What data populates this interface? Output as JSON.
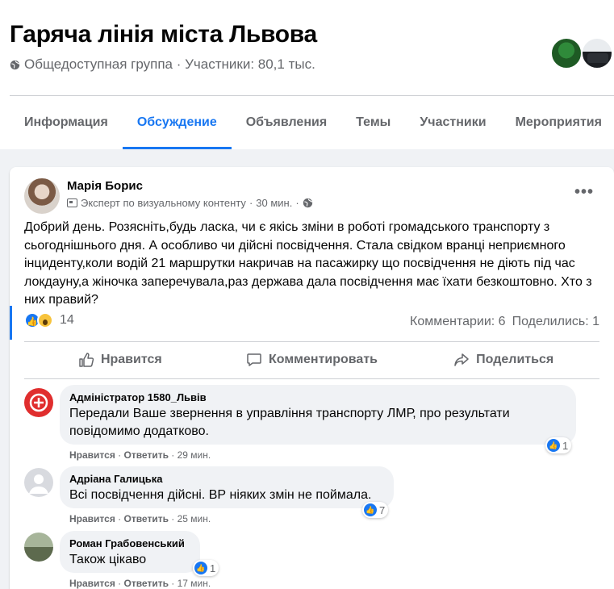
{
  "group": {
    "title": "Гаряча лінія міста Львова",
    "meta": "Общедоступная группа · Участники: 80,1 тыс."
  },
  "tabs": [
    "Информация",
    "Обсуждение",
    "Объявления",
    "Темы",
    "Участники",
    "Мероприятия"
  ],
  "active_tab": "Обсуждение",
  "post": {
    "author": "Марія Борис",
    "badge": "Эксперт по визуальному контенту",
    "time": "30 мин.",
    "text": "Добрий день. Розясніть,будь ласка, чи є якісь зміни в роботі громадського транспорту з сьогоднішнього дня. А особливо чи дійсні посвідчення. Стала свідком вранці неприємного інциденту,коли водій 21 маршрутки накричав на пасажирку що посвідчення не діють під час локдауну,а жіночка заперечувала,раз держава дала посвідчення має їхати безкоштовно. Хто з них правий?",
    "reactions_count": "14",
    "comments_count": "Комментарии: 6",
    "shares_count": "Поделились: 1"
  },
  "actions": {
    "like": "Нравится",
    "comment": "Комментировать",
    "share": "Поделиться"
  },
  "comments": [
    {
      "name": "Адміністратор 1580_Львів",
      "text": "Передали Ваше звернення в управління транспорту ЛМР, про результати повідомимо додатково.",
      "like": "Нравится",
      "reply": "Ответить",
      "time": "29 мин.",
      "reactions": "1"
    },
    {
      "name": "Адріана Галицька",
      "text": "Всі посвідчення дійсні. ВР ніяких змін не поймала.",
      "like": "Нравится",
      "reply": "Ответить",
      "time": "25 мин.",
      "reactions": "7"
    },
    {
      "name": "Роман Грабовенський",
      "text": "Також цікаво",
      "like": "Нравится",
      "reply": "Ответить",
      "time": "17 мин.",
      "reactions": "1"
    }
  ],
  "colors": {
    "accent": "#1877f2",
    "muted": "#65676b",
    "bubble": "#f0f2f5"
  }
}
